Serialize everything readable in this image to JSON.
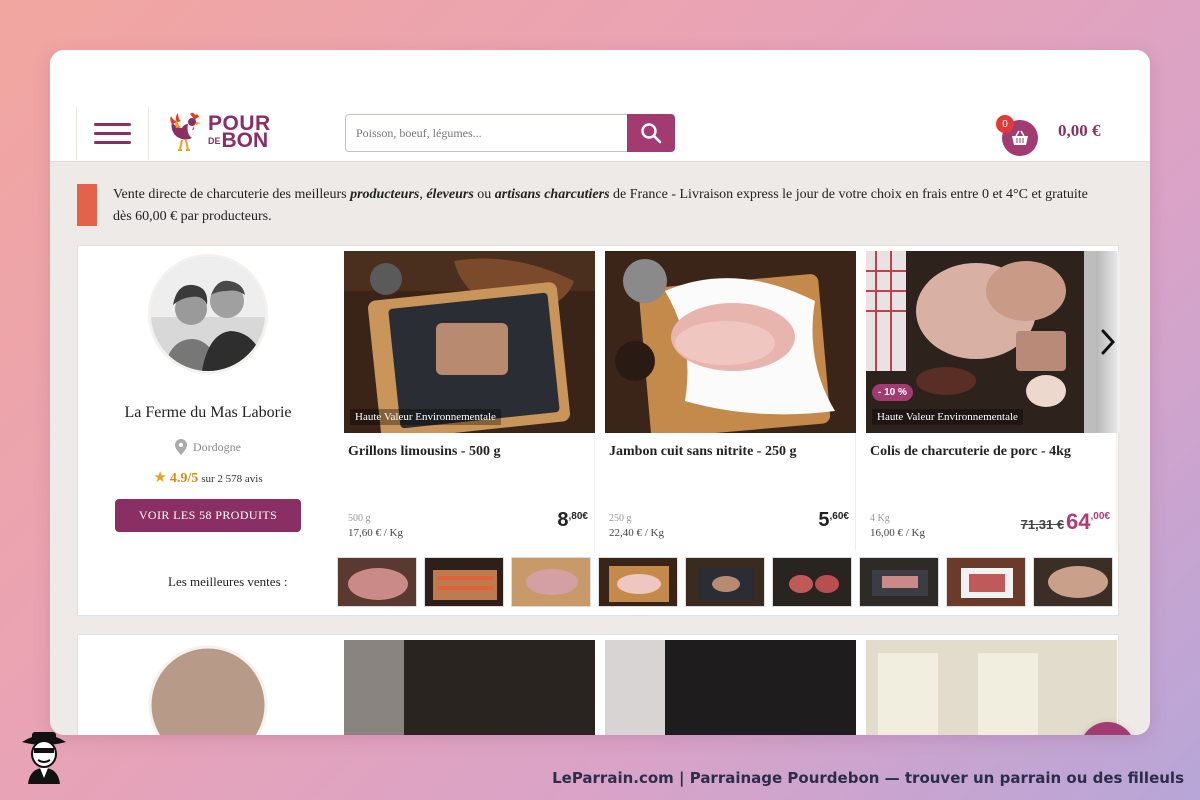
{
  "header": {
    "logo": {
      "line1": "POUR",
      "de": "DE",
      "line2": "BON"
    },
    "search_placeholder": "Poisson, boeuf, légumes...",
    "cart_count": "0",
    "cart_total": "0,00 €"
  },
  "intro": {
    "before1": "Vente directe de charcuterie des meilleurs ",
    "em1": "producteurs",
    "sep1": ", ",
    "em2": "éleveurs",
    "sep2": " ou ",
    "em3": "artisans charcutiers",
    "after": " de France - Livraison express le jour de votre choix en frais entre 0 et 4°C et gratuite dès 60,00 € par producteurs."
  },
  "producer": {
    "name": "La Ferme du Mas Laborie",
    "location": "Dordogne",
    "rating": "4.9/5",
    "reviews": "sur 2 578 avis",
    "button": "VOIR LES 58 PRODUITS",
    "best_sellers_label": "Les meilleures ventes :"
  },
  "products": [
    {
      "title": "Grillons limousins - 500 g",
      "tag": "Haute Valeur Environnementale",
      "weight": "500 g",
      "price_kg": "17,60 € / Kg",
      "price_int": "8",
      "price_dec": ",80€"
    },
    {
      "title": "Jambon cuit sans nitrite - 250 g",
      "weight": "250 g",
      "price_kg": "22,40 € / Kg",
      "price_int": "5",
      "price_dec": ",60€"
    },
    {
      "title": "Colis de charcuterie de porc - 4kg",
      "tag": "Haute Valeur Environnementale",
      "promo": "- 10 %",
      "weight": "4 Kg",
      "price_kg": "16,00 € / Kg",
      "old_price": "71,31 €",
      "price_int": "64",
      "price_dec": ",00€"
    }
  ],
  "footer": {
    "caption": "LeParrain.com | Parrainage Pourdebon — trouver un parrain ou des filleuls"
  },
  "colors": {
    "brand": "#8a2f63",
    "accent": "#a23b72",
    "intro_bar": "#e2624c",
    "rating": "#d38a18"
  }
}
